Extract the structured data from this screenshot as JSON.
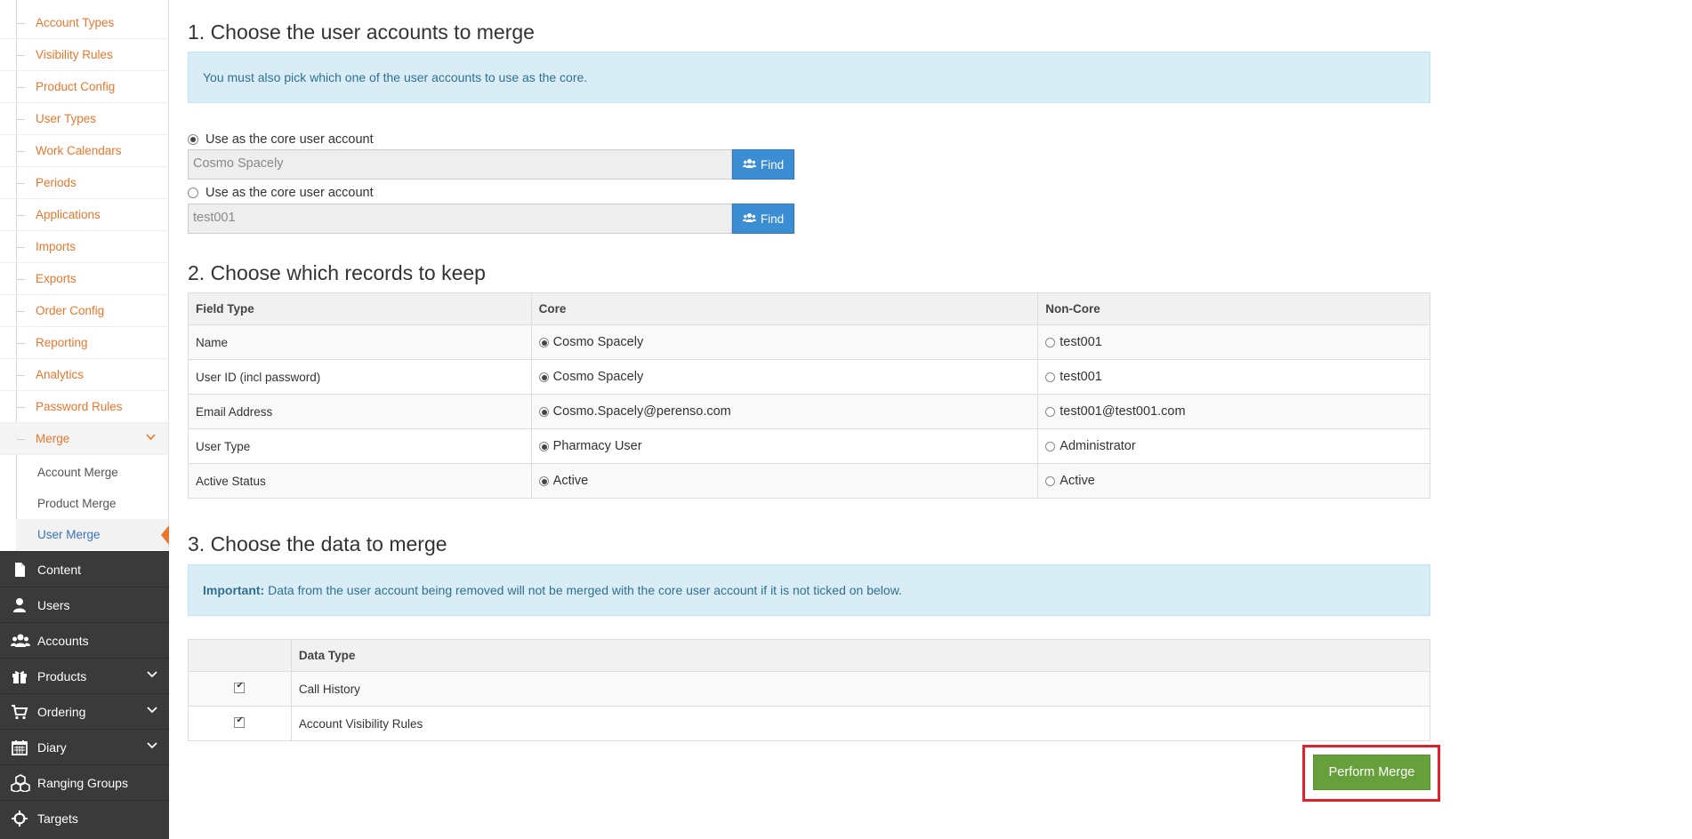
{
  "sidebar": {
    "sub_items": [
      {
        "label": "Account Types"
      },
      {
        "label": "Visibility Rules"
      },
      {
        "label": "Product Config"
      },
      {
        "label": "User Types"
      },
      {
        "label": "Work Calendars"
      },
      {
        "label": "Periods"
      },
      {
        "label": "Applications"
      },
      {
        "label": "Imports"
      },
      {
        "label": "Exports"
      },
      {
        "label": "Order Config"
      },
      {
        "label": "Reporting"
      },
      {
        "label": "Analytics"
      },
      {
        "label": "Password Rules"
      },
      {
        "label": "Merge"
      }
    ],
    "merge_children": [
      {
        "label": "Account Merge"
      },
      {
        "label": "Product Merge"
      },
      {
        "label": "User Merge"
      }
    ],
    "main_items": [
      {
        "label": "Content",
        "icon": "file-icon"
      },
      {
        "label": "Users",
        "icon": "user-icon"
      },
      {
        "label": "Accounts",
        "icon": "users-icon"
      },
      {
        "label": "Products",
        "icon": "gift-icon"
      },
      {
        "label": "Ordering",
        "icon": "cart-icon"
      },
      {
        "label": "Diary",
        "icon": "calendar-icon"
      },
      {
        "label": "Ranging Groups",
        "icon": "cubes-icon"
      },
      {
        "label": "Targets",
        "icon": "crosshairs-icon"
      }
    ]
  },
  "section1": {
    "title": "1. Choose the user accounts to merge",
    "alert": "You must also pick which one of the user accounts to use as the core.",
    "radio_label_1": "Use as the core user account",
    "value_1": "Cosmo Spacely",
    "radio_label_2": "Use as the core user account",
    "value_2": "test001",
    "find_label": "Find"
  },
  "section2": {
    "title": "2. Choose which records to keep",
    "headers": [
      "Field Type",
      "Core",
      "Non-Core"
    ],
    "rows": [
      {
        "field": "Name",
        "core": "Cosmo Spacely",
        "noncore": "test001"
      },
      {
        "field": "User ID (incl password)",
        "core": "Cosmo Spacely",
        "noncore": "test001"
      },
      {
        "field": "Email Address",
        "core": "Cosmo.Spacely@perenso.com",
        "noncore": "test001@test001.com"
      },
      {
        "field": "User Type",
        "core": "Pharmacy User",
        "noncore": "Administrator"
      },
      {
        "field": "Active Status",
        "core": "Active",
        "noncore": "Active"
      }
    ]
  },
  "section3": {
    "title": "3. Choose the data to merge",
    "alert_bold": "Important:",
    "alert_text": " Data from the user account being removed will not be merged with the core user account if it is not ticked on below.",
    "header": "Data Type",
    "rows": [
      {
        "label": "Call History",
        "checked": true
      },
      {
        "label": "Account Visibility Rules",
        "checked": true
      }
    ]
  },
  "perform_merge_label": "Perform Merge",
  "colors": {
    "accent_orange": "#e8772e",
    "find_blue": "#3b8dd4",
    "merge_green": "#66a03b",
    "highlight_red": "#e0202a",
    "sidebar_dark": "#3a3a3a"
  }
}
